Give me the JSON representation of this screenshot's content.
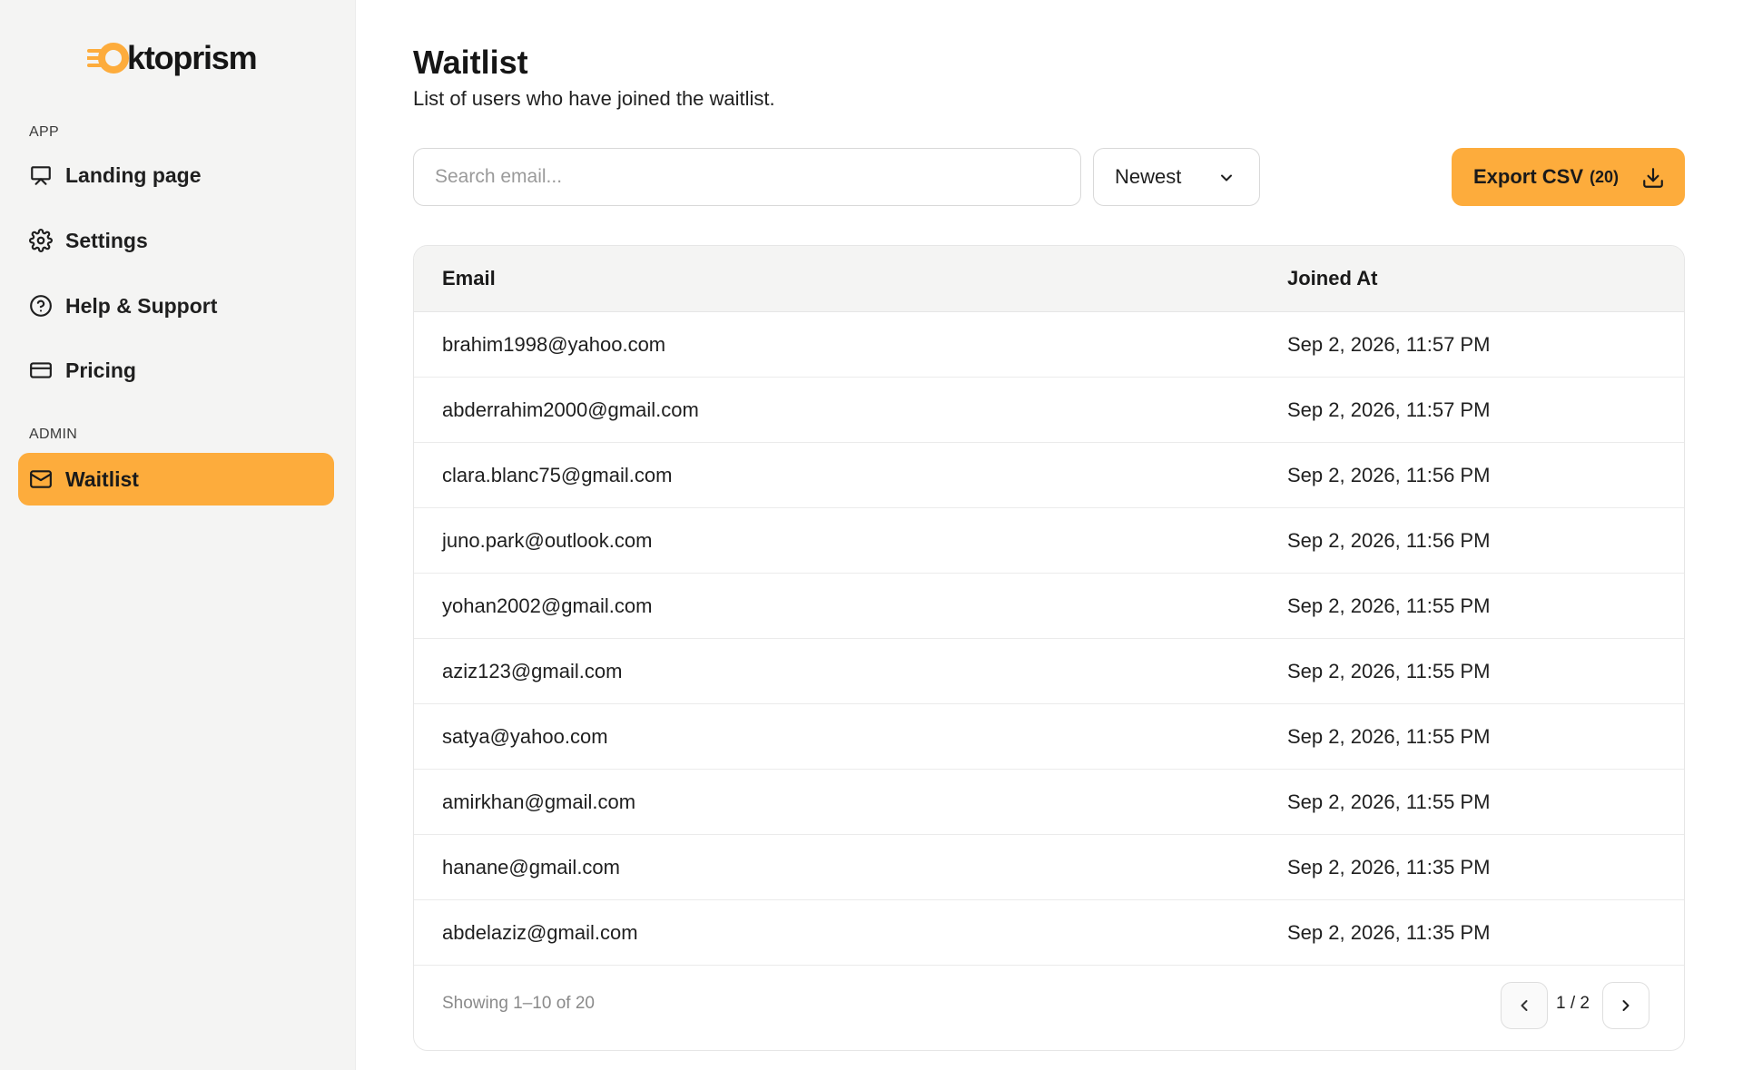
{
  "brand": {
    "name": "ktoprism",
    "accent": "#fdac3c"
  },
  "sidebar": {
    "sections": [
      {
        "label": "APP"
      },
      {
        "label": "ADMIN"
      }
    ],
    "items": [
      {
        "label": "Landing page",
        "icon": "presentation-icon"
      },
      {
        "label": "Settings",
        "icon": "gear-icon"
      },
      {
        "label": "Help & Support",
        "icon": "help-circle-icon"
      },
      {
        "label": "Pricing",
        "icon": "credit-card-icon"
      },
      {
        "label": "Waitlist",
        "icon": "mail-icon",
        "active": true
      }
    ]
  },
  "page": {
    "title": "Waitlist",
    "subtitle": "List of users who have joined the waitlist."
  },
  "toolbar": {
    "search_placeholder": "Search email...",
    "search_value": "",
    "sort_value": "Newest",
    "export_label": "Export CSV",
    "export_count": "(20)"
  },
  "table": {
    "columns": [
      "Email",
      "Joined At"
    ],
    "rows": [
      {
        "email": "brahim1998@yahoo.com",
        "joined": "Sep 2, 2026, 11:57 PM"
      },
      {
        "email": "abderrahim2000@gmail.com",
        "joined": "Sep 2, 2026, 11:57 PM"
      },
      {
        "email": "clara.blanc75@gmail.com",
        "joined": "Sep 2, 2026, 11:56 PM"
      },
      {
        "email": "juno.park@outlook.com",
        "joined": "Sep 2, 2026, 11:56 PM"
      },
      {
        "email": "yohan2002@gmail.com",
        "joined": "Sep 2, 2026, 11:55 PM"
      },
      {
        "email": "aziz123@gmail.com",
        "joined": "Sep 2, 2026, 11:55 PM"
      },
      {
        "email": "satya@yahoo.com",
        "joined": "Sep 2, 2026, 11:55 PM"
      },
      {
        "email": "amirkhan@gmail.com",
        "joined": "Sep 2, 2026, 11:55 PM"
      },
      {
        "email": "hanane@gmail.com",
        "joined": "Sep 2, 2026, 11:35 PM"
      },
      {
        "email": "abdelaziz@gmail.com",
        "joined": "Sep 2, 2026, 11:35 PM"
      }
    ],
    "footer": {
      "showing": "Showing 1–10 of 20",
      "page": "1 / 2"
    }
  }
}
